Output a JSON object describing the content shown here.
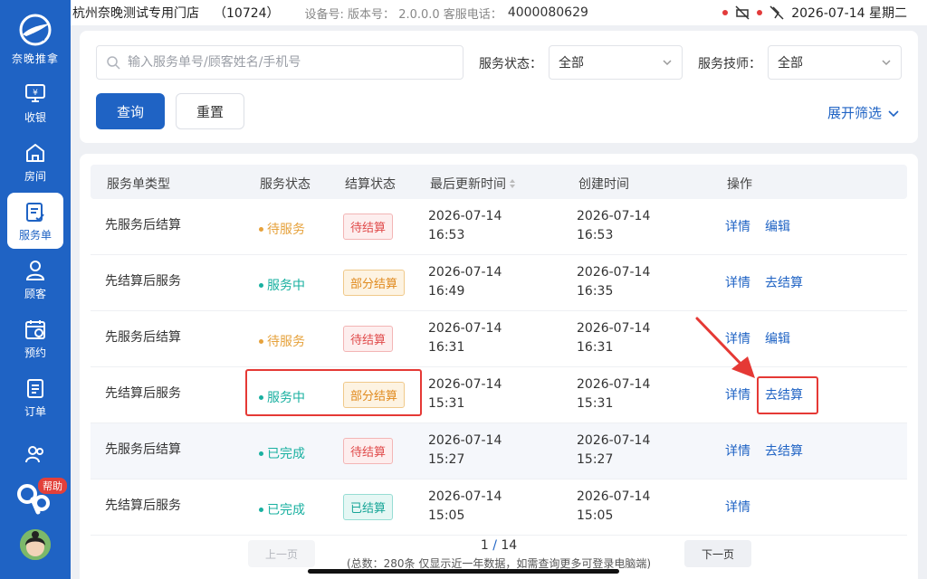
{
  "sidebar": {
    "logo_text": "奈晚推拿",
    "items": [
      {
        "label": "收银",
        "icon": "cashier-icon"
      },
      {
        "label": "房间",
        "icon": "house-icon"
      },
      {
        "label": "服务单",
        "icon": "service-order-icon"
      },
      {
        "label": "顾客",
        "icon": "user-icon"
      },
      {
        "label": "预约",
        "icon": "calendar-icon"
      },
      {
        "label": "订单",
        "icon": "order-list-icon"
      },
      {
        "label": "",
        "icon": "staff-icon"
      }
    ],
    "active_index": 2,
    "help_label": "帮助"
  },
  "statusbar": {
    "store_name": "杭州奈晚测试专用门店",
    "store_code": "（10724）",
    "device_info": "设备号:  版本号： 2.0.0.0  客服电话：",
    "service_phone": "4000080629",
    "datetime": "2026-07-14 星期二"
  },
  "filters": {
    "search_placeholder": "输入服务单号/顾客姓名/手机号",
    "status_label": "服务状态：",
    "status_value": "全部",
    "tech_label": "服务技师：",
    "tech_value": "全部",
    "query_label": "查询",
    "reset_label": "重置",
    "expand_label": "展开筛选"
  },
  "table": {
    "headers": [
      "服务单类型",
      "服务状态",
      "结算状态",
      "最后更新时间",
      "创建时间",
      "操作"
    ],
    "rows": [
      {
        "type": "先服务后结算",
        "status": "待服务",
        "status_color": "#e6a23c",
        "settle": "待结算",
        "settle_style": "red",
        "updated_date": "2026-07-14",
        "updated_time": "16:53",
        "created_date": "2026-07-14",
        "created_time": "16:53",
        "op1": "详情",
        "op2": "编辑"
      },
      {
        "type": "先结算后服务",
        "status": "服务中",
        "status_color": "#19b0a0",
        "settle": "部分结算",
        "settle_style": "orange",
        "updated_date": "2026-07-14",
        "updated_time": "16:49",
        "created_date": "2026-07-14",
        "created_time": "16:35",
        "op1": "详情",
        "op2": "去结算"
      },
      {
        "type": "先服务后结算",
        "status": "待服务",
        "status_color": "#e6a23c",
        "settle": "待结算",
        "settle_style": "red",
        "updated_date": "2026-07-14",
        "updated_time": "16:31",
        "created_date": "2026-07-14",
        "created_time": "16:31",
        "op1": "详情",
        "op2": "编辑"
      },
      {
        "type": "先结算后服务",
        "status": "服务中",
        "status_color": "#19b0a0",
        "settle": "部分结算",
        "settle_style": "orange",
        "updated_date": "2026-07-14",
        "updated_time": "15:31",
        "created_date": "2026-07-14",
        "created_time": "15:31",
        "op1": "详情",
        "op2": "去结算"
      },
      {
        "type": "先服务后结算",
        "status": "已完成",
        "status_color": "#19b0a0",
        "settle": "待结算",
        "settle_style": "red",
        "updated_date": "2026-07-14",
        "updated_time": "15:27",
        "created_date": "2026-07-14",
        "created_time": "15:27",
        "op1": "详情",
        "op2": "去结算"
      },
      {
        "type": "先结算后服务",
        "status": "已完成",
        "status_color": "#19b0a0",
        "settle": "已结算",
        "settle_style": "teal",
        "updated_date": "2026-07-14",
        "updated_time": "15:05",
        "created_date": "2026-07-14",
        "created_time": "15:05",
        "op1": "详情",
        "op2": ""
      }
    ]
  },
  "pagination": {
    "prev_label": "上一页",
    "next_label": "下一页",
    "current": "1",
    "separator": "/",
    "total_pages": "14",
    "total_text": "(总数：280条 仅显示近一年数据，如需查询更多可登录电脑端)"
  },
  "colors": {
    "primary": "#1f63c4",
    "annotation": "#e53935"
  }
}
